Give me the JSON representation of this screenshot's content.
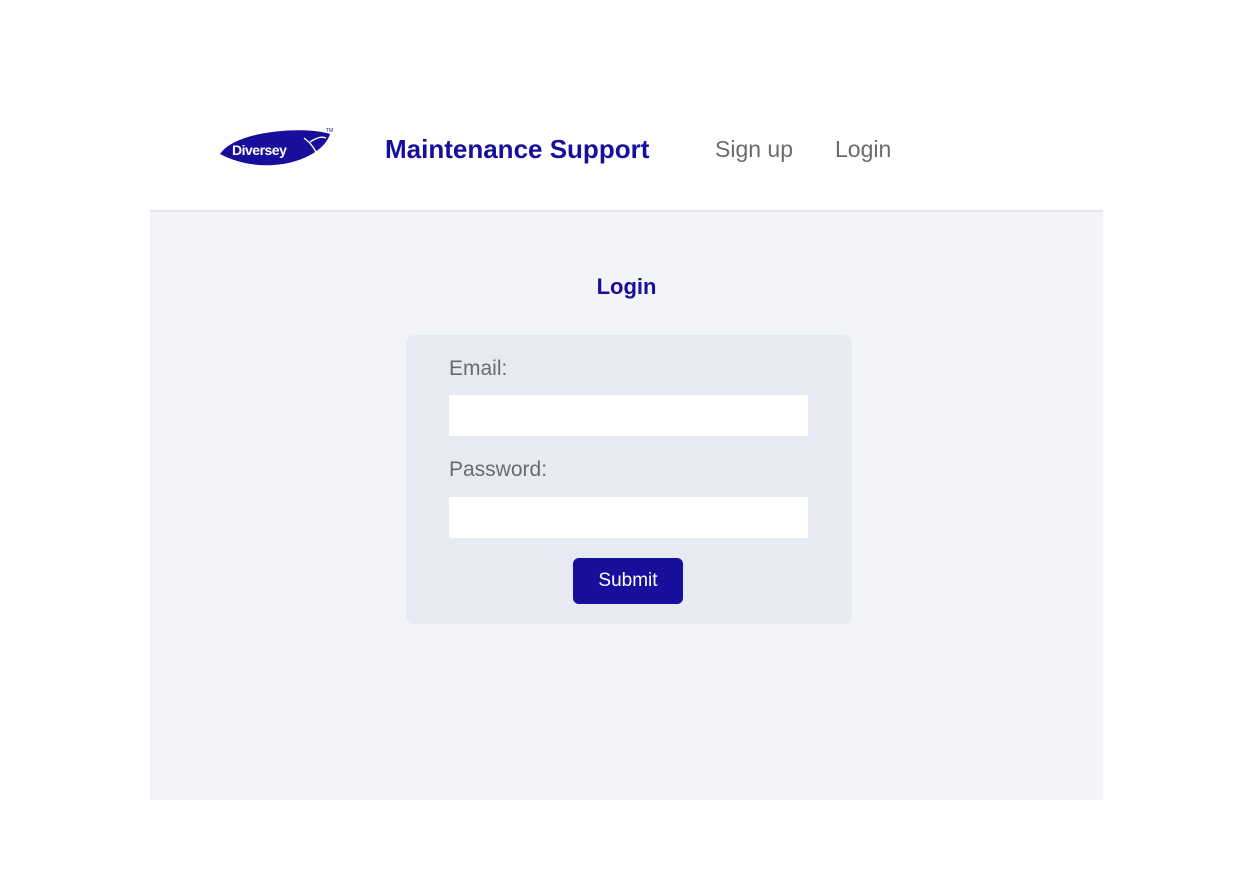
{
  "header": {
    "logo_text": "Diversey",
    "brand": "Maintenance Support",
    "nav": {
      "signup": "Sign up",
      "login": "Login"
    }
  },
  "main": {
    "title": "Login",
    "form": {
      "email_label": "Email:",
      "email_value": "",
      "password_label": "Password:",
      "password_value": "",
      "submit_label": "Submit"
    }
  },
  "colors": {
    "brand": "#170e9c",
    "nav_text": "#6b6b6b",
    "page_bg": "#f3f4f8",
    "card_bg": "#e7e9f3"
  },
  "icons": {
    "logo": "diversey-leaf-logo-icon"
  }
}
